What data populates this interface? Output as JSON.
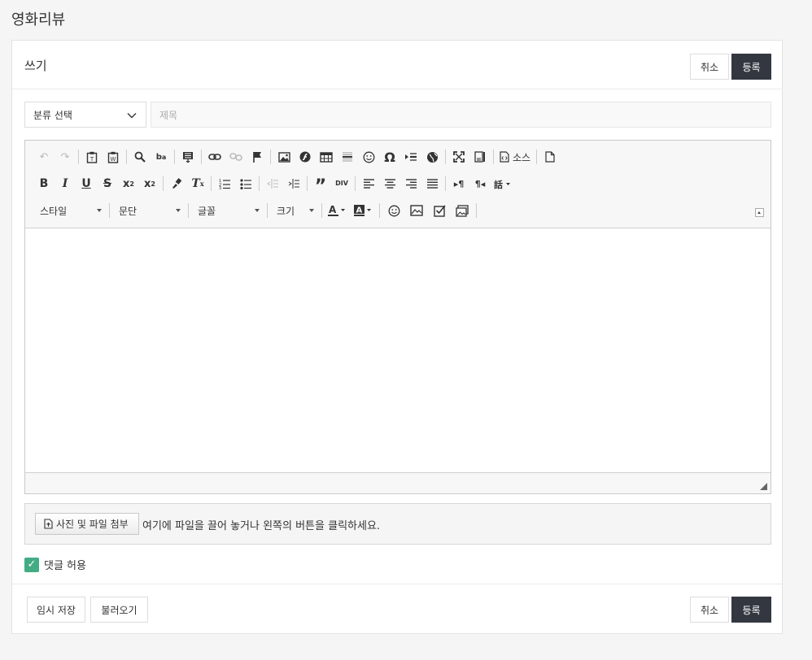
{
  "page": {
    "title": "영화리뷰"
  },
  "form": {
    "title": "쓰기",
    "cancel_label": "취소",
    "submit_label": "등록",
    "category": {
      "value": "분류 선택"
    },
    "subject": {
      "placeholder": "제목"
    }
  },
  "editor": {
    "source_label": "소스",
    "styles_label": "스타일",
    "format_label": "문단",
    "font_label": "글꼴",
    "size_label": "크기"
  },
  "attach": {
    "button_label": "사진 및 파일 첨부",
    "hint": "여기에 파일을 끌어 놓거나 왼쪽의 버튼을 클릭하세요."
  },
  "options": {
    "allow_comment_label": "댓글 허용",
    "allow_comment_checked": true
  },
  "footer": {
    "temp_save_label": "임시 저장",
    "load_label": "불러오기",
    "cancel_label": "취소",
    "submit_label": "등록"
  },
  "colors": {
    "primary_button": "#333840",
    "checkbox": "#43ac84"
  }
}
